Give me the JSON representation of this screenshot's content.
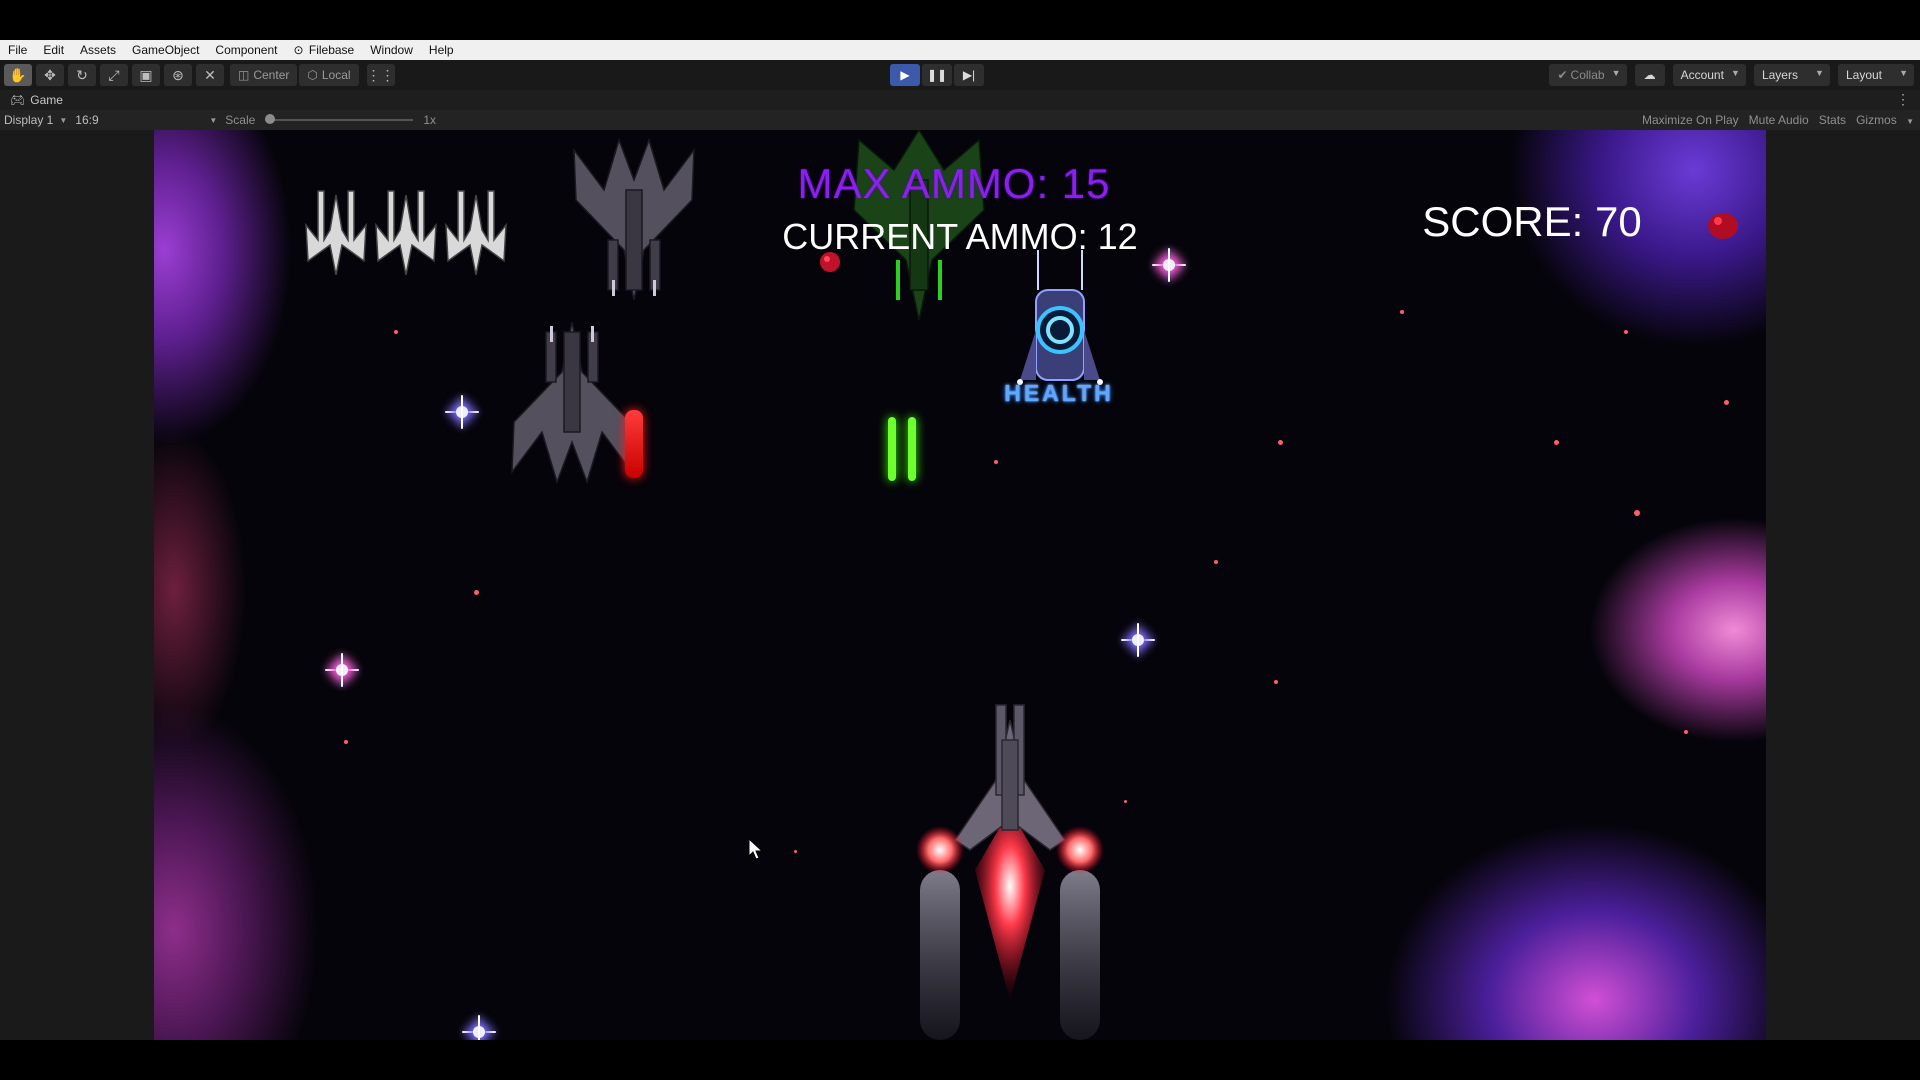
{
  "menu": [
    "File",
    "Edit",
    "Assets",
    "GameObject",
    "Component",
    "Filebase",
    "Window",
    "Help"
  ],
  "toolbar": {
    "tools": [
      "hand-icon",
      "move-icon",
      "rotate-icon",
      "scale-icon",
      "rect-icon",
      "transform-icon",
      "custom-tool-icon"
    ],
    "pivot": "Center",
    "space": "Local",
    "collab": "Collab",
    "account": "Account",
    "layers": "Layers",
    "layout": "Layout"
  },
  "tab": {
    "label": "Game"
  },
  "game_bar": {
    "display": "Display 1",
    "aspect": "16:9",
    "scale_label": "Scale",
    "scale_value": "1x",
    "maximize": "Maximize On Play",
    "mute": "Mute Audio",
    "stats": "Stats",
    "gizmos": "Gizmos"
  },
  "hud": {
    "max_ammo": "MAX AMMO: 15",
    "current_ammo": "CURRENT AMMO: 12",
    "score": "SCORE: 70",
    "lives": 3
  },
  "pickup": {
    "label": "HEALTH"
  },
  "colors": {
    "max_ammo": "#8a1ff0",
    "hud_text": "#ffffff",
    "health_glow": "#1e7bff",
    "enemy_laser": "#ff1a1a",
    "player_laser": "#6dff2e",
    "play_active": "#3b5aa9"
  }
}
